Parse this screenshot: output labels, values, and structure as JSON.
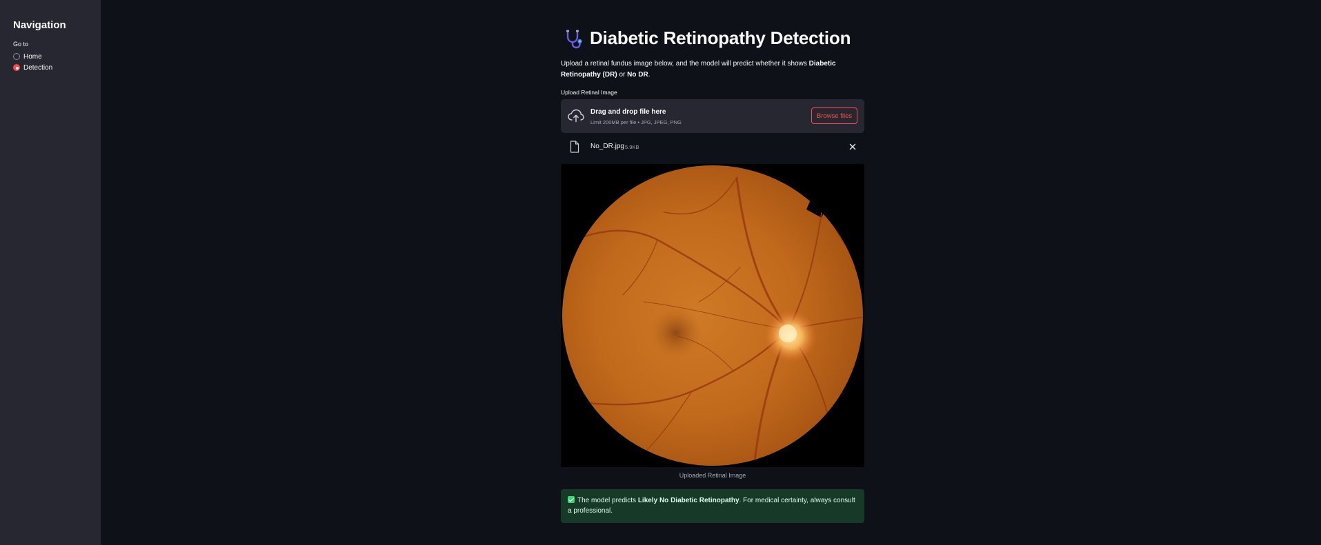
{
  "sidebar": {
    "title": "Navigation",
    "goto_label": "Go to",
    "options": [
      {
        "label": "Home",
        "selected": false
      },
      {
        "label": "Detection",
        "selected": true
      }
    ]
  },
  "main": {
    "title": "Diabetic Retinopathy Detection",
    "title_icon": "stethoscope-icon",
    "intro_prefix": "Upload a retinal fundus image below, and the model will predict whether it shows ",
    "intro_bold1": "Diabetic Retinopathy (DR)",
    "intro_mid": " or ",
    "intro_bold2": "No DR",
    "intro_suffix": ".",
    "upload_label": "Upload Retinal Image",
    "dropzone": {
      "icon": "cloud-upload-icon",
      "title": "Drag and drop file here",
      "limit": "Limit 200MB per file • JPG, JPEG, PNG",
      "browse_label": "Browse files"
    },
    "uploaded_file": {
      "icon": "file-icon",
      "name": "No_DR.jpg",
      "size": "5.9KB",
      "remove_icon": "close-icon"
    },
    "image_caption": "Uploaded Retinal Image",
    "result": {
      "icon": "check-icon",
      "prefix": "The model predicts ",
      "bold": "Likely No Diabetic Retinopathy",
      "suffix": ". For medical certainty, always consult a professional."
    }
  },
  "colors": {
    "background": "#0e1117",
    "sidebar": "#262730",
    "accent": "#ff4b4b",
    "success_bg": "#173928",
    "success_text": "#dffde9"
  }
}
